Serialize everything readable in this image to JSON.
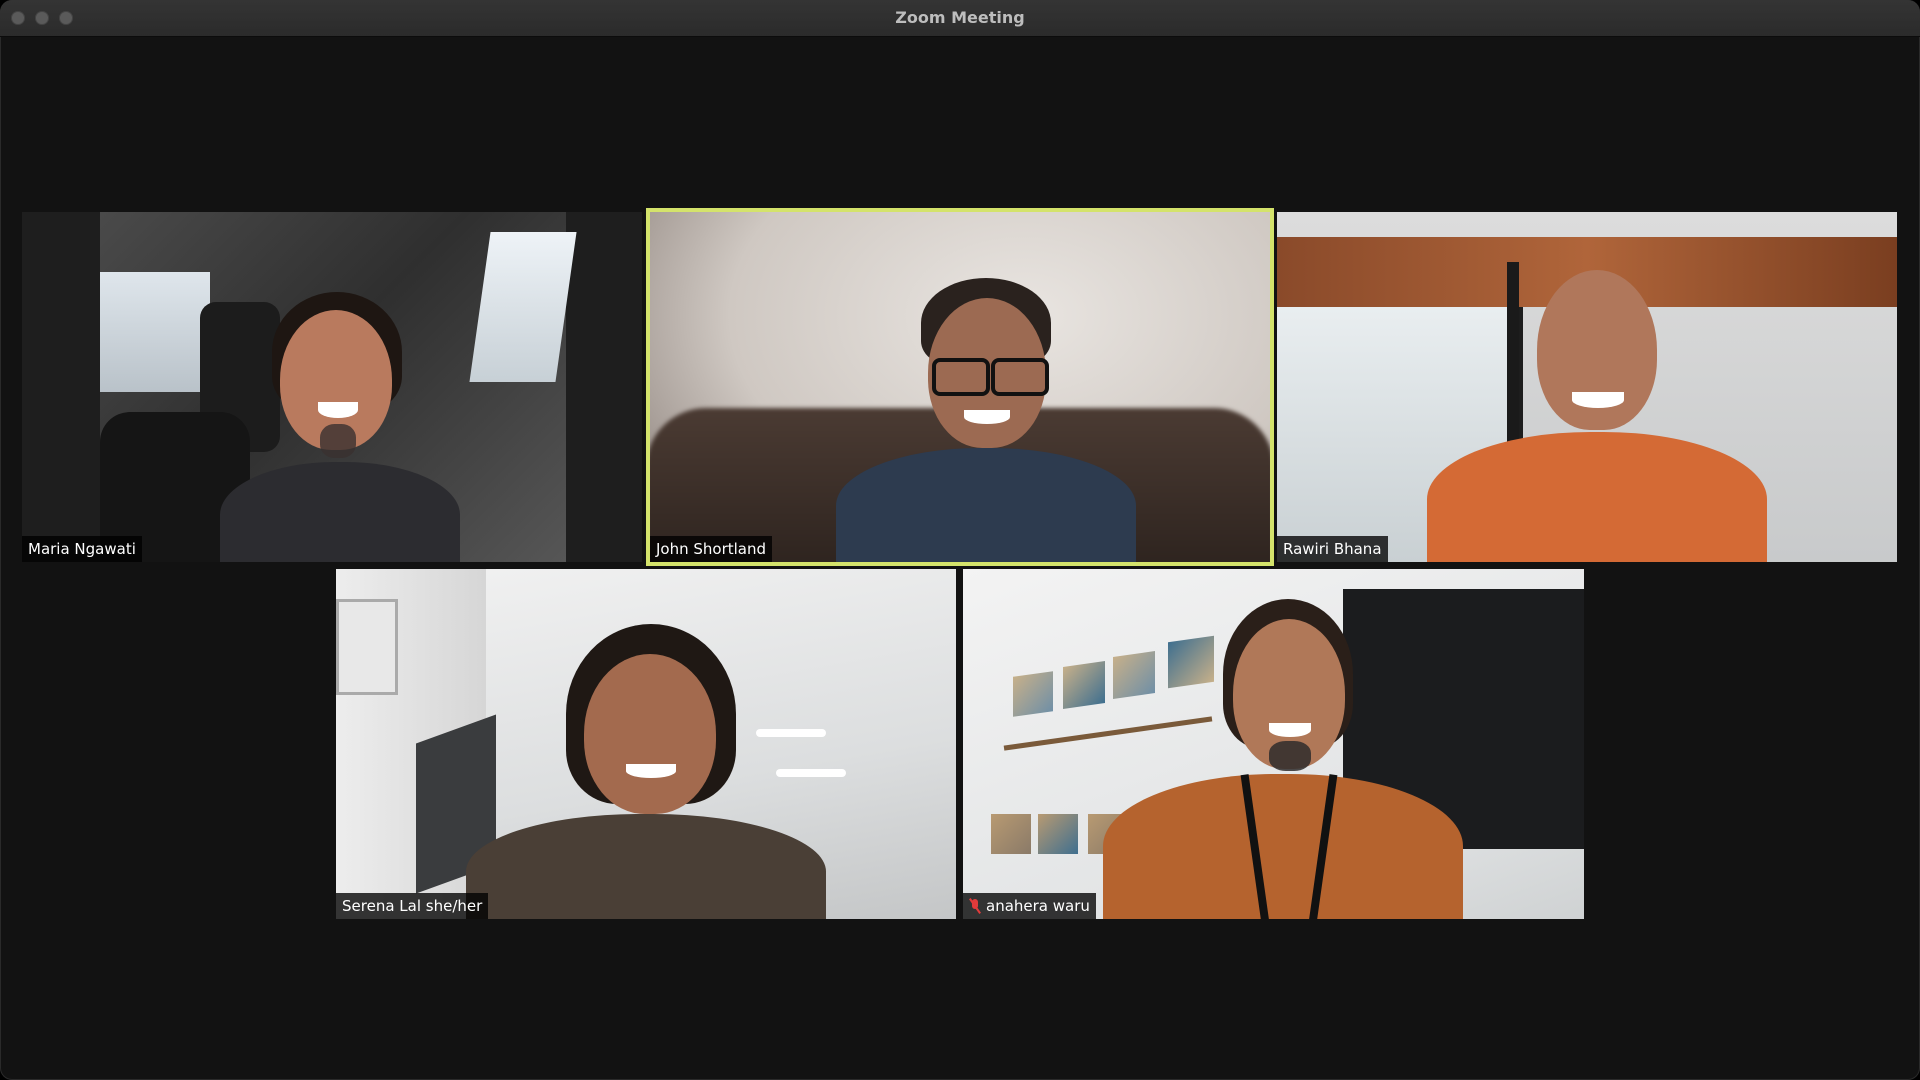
{
  "window": {
    "title": "Zoom Meeting",
    "controls": [
      {
        "name": "close-window-button",
        "color": "#5a5a5a"
      },
      {
        "name": "minimize-window-button",
        "color": "#5a5a5a"
      },
      {
        "name": "maximize-window-button",
        "color": "#5a5a5a"
      }
    ]
  },
  "active_speaker_color": "#d4e36b",
  "participants": [
    {
      "name": "Maria Ngawati",
      "muted": false,
      "active": false
    },
    {
      "name": "John Shortland",
      "muted": false,
      "active": true
    },
    {
      "name": "Rawiri Bhana",
      "muted": false,
      "active": false
    },
    {
      "name": "Serena Lal she/her",
      "muted": false,
      "active": false
    },
    {
      "name": "anahera waru",
      "muted": true,
      "active": false
    }
  ]
}
